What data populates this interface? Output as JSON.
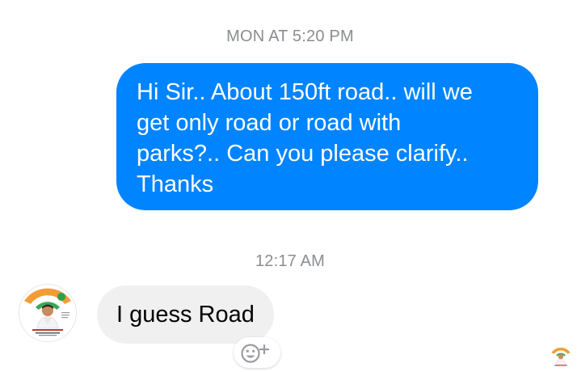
{
  "thread": {
    "timestamp_1": "MON AT 5:20 PM",
    "outgoing_message": {
      "lines": [
        "Hi Sir.. About 150ft road.. will we",
        "get only road or road with",
        "parks?.. Can you please clarify..",
        "Thanks"
      ]
    },
    "timestamp_2": "12:17 AM",
    "incoming_message": {
      "text": "I guess Road"
    }
  },
  "colors": {
    "outgoing_bubble": "#0084ff",
    "incoming_bubble": "#f1f0f0",
    "timestamp_text": "#8a8d91",
    "background": "#ffffff"
  },
  "icons": {
    "reaction": "add-reaction-icon",
    "avatar": "contact-avatar",
    "read_receipt": "seen-avatar"
  }
}
